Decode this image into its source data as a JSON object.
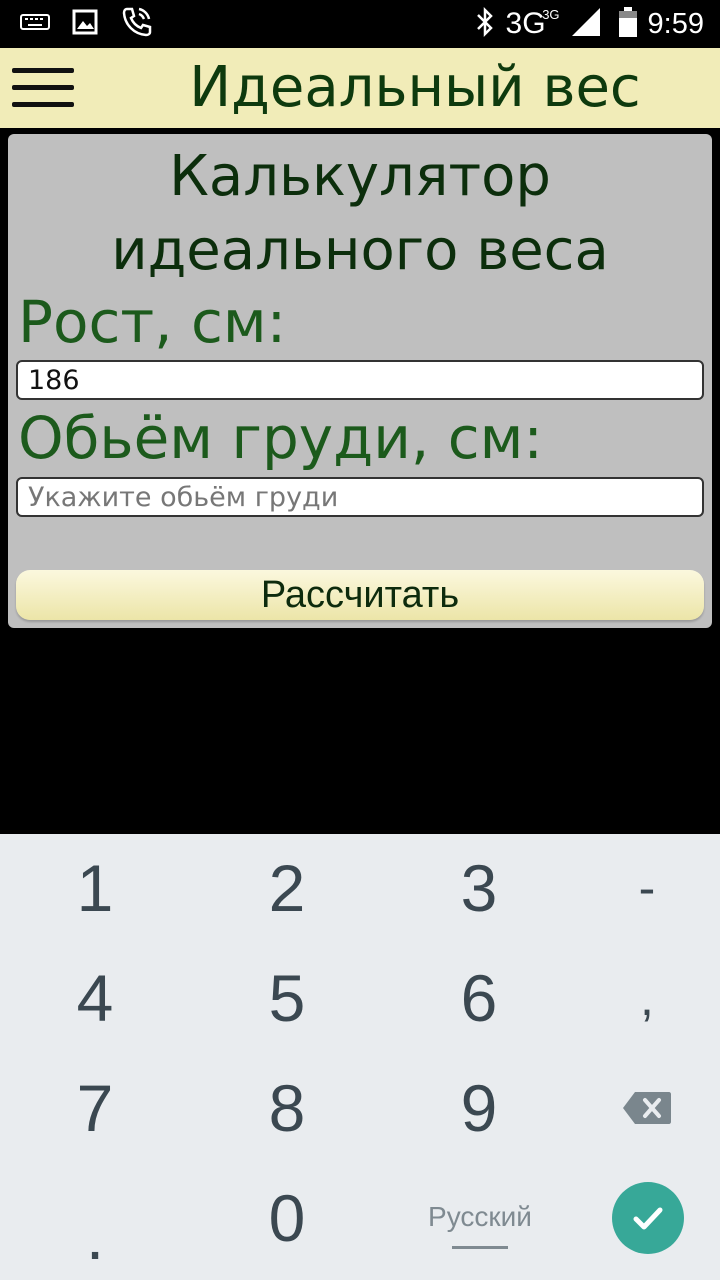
{
  "status_bar": {
    "time": "9:59",
    "network": "3G",
    "network_sub": "3G",
    "icons": [
      "keyboard-icon",
      "image-icon",
      "phone-call-icon",
      "bluetooth-icon",
      "signal-icon",
      "battery-icon"
    ]
  },
  "app_bar": {
    "title": "Идеальный вес",
    "background": "#f1ecb8"
  },
  "card": {
    "title_line1": "Калькулятор",
    "title_line2": "идеального веса",
    "height_label": "Рост, см:",
    "height_value": "186",
    "chest_label": "Обьём груди, см:",
    "chest_placeholder": "Укажите обьём груди",
    "chest_value": "",
    "calculate_label": "Рассчитать"
  },
  "keyboard": {
    "row1": [
      "1",
      "2",
      "3",
      "-"
    ],
    "row2": [
      "4",
      "5",
      "6",
      ","
    ],
    "row3": [
      "7",
      "8",
      "9"
    ],
    "row4_left": ".",
    "row4_zero": "0",
    "language_label": "Русский",
    "enter_color": "#37a898"
  }
}
